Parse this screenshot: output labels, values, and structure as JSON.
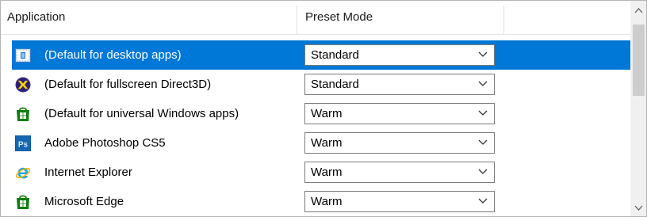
{
  "header": {
    "col_application": "Application",
    "col_preset_mode": "Preset Mode"
  },
  "rows": [
    {
      "icon": "desktop-app-icon",
      "label": "(Default for desktop apps)",
      "mode": "Standard",
      "selected": true
    },
    {
      "icon": "directx-icon",
      "label": "(Default for fullscreen Direct3D)",
      "mode": "Standard",
      "selected": false
    },
    {
      "icon": "store-app-icon",
      "label": "(Default for universal Windows apps)",
      "mode": "Warm",
      "selected": false
    },
    {
      "icon": "photoshop-icon",
      "label": "Adobe Photoshop CS5",
      "mode": "Warm",
      "selected": false
    },
    {
      "icon": "internet-explorer-icon",
      "label": "Internet Explorer",
      "mode": "Warm",
      "selected": false
    },
    {
      "icon": "store-app-icon",
      "label": "Microsoft Edge",
      "mode": "Warm",
      "selected": false
    }
  ],
  "icon_texts": {
    "photoshop": "Ps"
  },
  "colors": {
    "selection": "#0078d7",
    "dropdown_border": "#7a7a7a",
    "store_green": "#107c10",
    "ps_blue": "#0b5b9e"
  }
}
